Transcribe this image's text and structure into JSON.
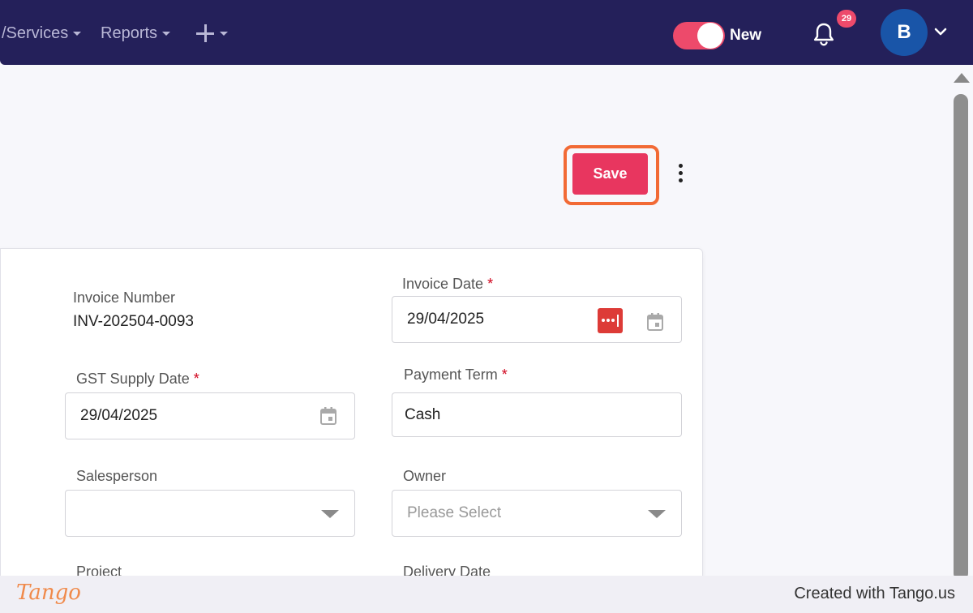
{
  "nav": {
    "items": [
      {
        "label": "/Services"
      },
      {
        "label": "Reports"
      }
    ],
    "toggle_label": "New",
    "notification_count": "29",
    "avatar_initial": "B"
  },
  "toolbar": {
    "save_label": "Save"
  },
  "form": {
    "invoice_number": {
      "label": "Invoice Number",
      "value": "INV-202504-0093"
    },
    "invoice_date": {
      "label": "Invoice Date",
      "required": "*",
      "value": "29/04/2025"
    },
    "gst_supply_date": {
      "label": "GST Supply Date",
      "required": "*",
      "value": "29/04/2025"
    },
    "payment_term": {
      "label": "Payment Term",
      "required": "*",
      "value": "Cash"
    },
    "salesperson": {
      "label": "Salesperson",
      "value": ""
    },
    "owner": {
      "label": "Owner",
      "placeholder": "Please Select"
    },
    "project": {
      "label": "Project"
    },
    "delivery_date": {
      "label": "Delivery Date"
    }
  },
  "footer": {
    "logo": "Tango",
    "credit": "Created with Tango.us"
  },
  "colors": {
    "nav_bg": "#24205a",
    "accent": "#e8365f",
    "highlight": "#f26a35",
    "avatar": "#1955a8"
  }
}
